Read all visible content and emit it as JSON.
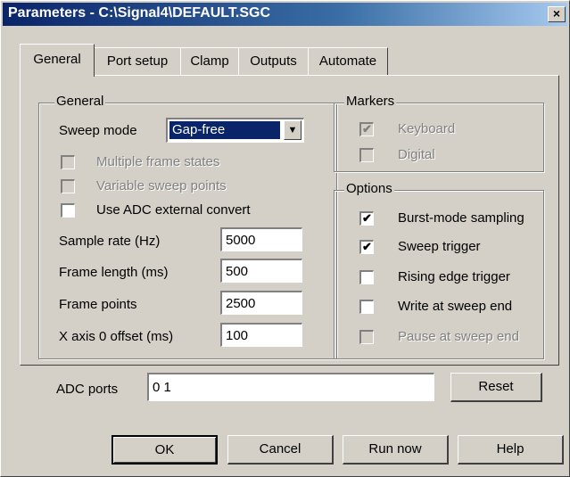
{
  "window": {
    "title": "Parameters - C:\\Signal4\\DEFAULT.SGC",
    "close_glyph": "×"
  },
  "tabs": [
    {
      "label": "General"
    },
    {
      "label": "Port setup"
    },
    {
      "label": "Clamp"
    },
    {
      "label": "Outputs"
    },
    {
      "label": "Automate"
    }
  ],
  "general": {
    "group_label": "General",
    "sweep_mode_label": "Sweep mode",
    "sweep_mode_value": "Gap-free",
    "checks": [
      {
        "label": "Multiple frame states",
        "checked": false,
        "enabled": false
      },
      {
        "label": "Variable sweep points",
        "checked": false,
        "enabled": false
      },
      {
        "label": "Use ADC external convert",
        "checked": false,
        "enabled": true
      }
    ],
    "fields": [
      {
        "label": "Sample rate (Hz)",
        "value": "5000"
      },
      {
        "label": "Frame length (ms)",
        "value": "500"
      },
      {
        "label": "Frame points",
        "value": "2500"
      },
      {
        "label": "X axis 0 offset (ms)",
        "value": "100"
      }
    ]
  },
  "markers": {
    "group_label": "Markers",
    "items": [
      {
        "label": "Keyboard",
        "checked": true,
        "enabled": false
      },
      {
        "label": "Digital",
        "checked": false,
        "enabled": false
      }
    ]
  },
  "options": {
    "group_label": "Options",
    "items": [
      {
        "label": "Burst-mode sampling",
        "checked": true,
        "enabled": true
      },
      {
        "label": "Sweep trigger",
        "checked": true,
        "enabled": true
      },
      {
        "label": "Rising edge trigger",
        "checked": false,
        "enabled": true
      },
      {
        "label": "Write at sweep end",
        "checked": false,
        "enabled": true
      },
      {
        "label": "Pause at sweep end",
        "checked": false,
        "enabled": false
      }
    ]
  },
  "adc": {
    "label": "ADC ports",
    "value": "0 1",
    "reset_label": "Reset"
  },
  "buttons": {
    "ok": "OK",
    "cancel": "Cancel",
    "run_now": "Run now",
    "help": "Help"
  },
  "checkmark_glyph": "✔",
  "dropdown_glyph": "▼"
}
